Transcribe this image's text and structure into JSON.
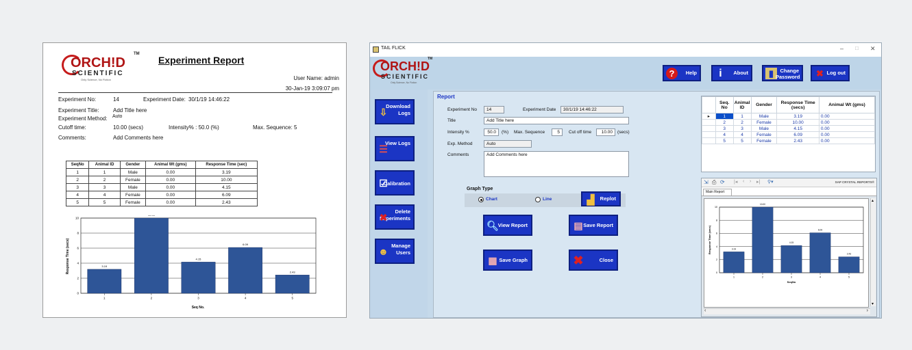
{
  "report_doc": {
    "logo": {
      "brand": "ORCH!D",
      "sub": "SCIENTIFIC",
      "tagline": "Only Science, No Fiction",
      "tm": "TM"
    },
    "title": "Experiment Report",
    "user_name": "User Name: admin",
    "printed_at": "30-Jan-19  3:09:07 pm",
    "experiment_no_label": "Experiment No:",
    "experiment_no": "14",
    "experiment_date_label": "Experiment Date:",
    "experiment_date": "30/1/19 14:46:22",
    "experiment_title_label": "Experiment Title:",
    "experiment_title": "Add Title here",
    "experiment_method_label": "Experiment Method:",
    "experiment_method": "Auto",
    "cutoff_label": "Cutoff time:",
    "cutoff": "10.00 (secs)",
    "intensity": "Intensity% : 50.0 (%)",
    "max_sequence": "Max. Sequence: 5",
    "comments_label": "Comments:",
    "comments": "Add Comments here",
    "table_headers": [
      "SeqNo",
      "Animal ID",
      "Gender",
      "Animal Wt (gms)",
      "Response Time (sec)"
    ],
    "table_rows": [
      [
        "1",
        "1",
        "Male",
        "0.00",
        "3.19"
      ],
      [
        "2",
        "2",
        "Female",
        "0.00",
        "10.00"
      ],
      [
        "3",
        "3",
        "Male",
        "0.00",
        "4.15"
      ],
      [
        "4",
        "4",
        "Female",
        "0.00",
        "6.09"
      ],
      [
        "5",
        "5",
        "Female",
        "0.00",
        "2.43"
      ]
    ],
    "chart_xlabel": "Seq No.",
    "chart_ylabel": "Response Time (secs)"
  },
  "app": {
    "window_title": "TAIL FLICK",
    "window_controls": {
      "minimize": "–",
      "maximize": "□",
      "close": "✕"
    },
    "logo": {
      "brand": "ORCH!D",
      "sub": "SCIENTIFIC",
      "tagline": "Only Science, No Fiction",
      "tm": "TM"
    },
    "top_buttons": {
      "help": "Help",
      "about": "About",
      "change_password": "Change Password",
      "logout": "Log out"
    },
    "sidebar": {
      "download_logs": "Download Logs",
      "view_logs": "View Logs",
      "calibration": "Calibration",
      "delete_experiments": "Delete Experiments",
      "manage_users": "Manage Users"
    },
    "report": {
      "heading": "Report",
      "experiment_no_label": "Experiment No",
      "experiment_no": "14",
      "experiment_date_label": "Experiment Date",
      "experiment_date": "30/1/19 14:46:22",
      "title_label": "Title",
      "title_value": "Add Title here",
      "intensity_label": "Intensity %",
      "intensity_value": "50.0",
      "intensity_unit": "(%)",
      "max_sequence_label": "Max. Sequence",
      "max_sequence_value": "5",
      "cutoff_label": "Cut off time",
      "cutoff_value": "10.00",
      "cutoff_unit": "(secs)",
      "method_label": "Exp. Method",
      "method_value": "Auto",
      "comments_label": "Comments",
      "comments_value": "Add Comments here",
      "graph_type_label": "Graph Type",
      "graph_type_options": [
        "Chart",
        "Line"
      ],
      "graph_type_selected": "Chart",
      "replot": "Replot",
      "view_report": "View Report",
      "save_report": "Save Report",
      "save_graph": "Save Graph",
      "close": "Close"
    },
    "grid": {
      "headers": [
        "Seq. No",
        "Animal ID",
        "Gender",
        "Response Time (secs)",
        "Animal Wt (gms)"
      ],
      "rows": [
        [
          "1",
          "1",
          "Male",
          "3.19",
          "0.00"
        ],
        [
          "2",
          "2",
          "Female",
          "10.00",
          "0.00"
        ],
        [
          "3",
          "3",
          "Male",
          "4.15",
          "0.00"
        ],
        [
          "4",
          "4",
          "Female",
          "6.09",
          "0.00"
        ],
        [
          "5",
          "5",
          "Female",
          "2.43",
          "0.00"
        ]
      ],
      "selected_row": 0
    },
    "viewer": {
      "brand": "SAP CRYSTAL REPORTS®",
      "tab": "Main Report",
      "chart_xlabel": "SeqNo",
      "chart_ylabel": "Response Time (secs)"
    }
  },
  "chart_data": [
    {
      "type": "bar",
      "categories": [
        "1",
        "2",
        "3",
        "4",
        "5"
      ],
      "values": [
        3.19,
        10.0,
        4.15,
        6.09,
        2.43
      ],
      "data_labels": [
        "3.19",
        "10.00",
        "4.15",
        "6.09",
        "2.43"
      ],
      "xlabel": "Seq No.",
      "ylabel": "Response Time (secs)",
      "ylim": [
        0,
        10
      ],
      "ticks": [
        "0",
        "2",
        "4",
        "6",
        "8",
        "10"
      ],
      "grid": true,
      "color": "#2e5597"
    },
    {
      "type": "bar",
      "categories": [
        "1",
        "2",
        "3",
        "4",
        "5"
      ],
      "values": [
        3.19,
        10.0,
        4.15,
        6.09,
        2.43
      ],
      "data_labels": [
        "3.19",
        "10.00",
        "4.15",
        "6.09",
        "2.43"
      ],
      "xlabel": "SeqNo",
      "ylabel": "Response Time (secs)",
      "ylim": [
        0,
        10
      ],
      "ticks": [
        "0",
        "2",
        "4",
        "6",
        "8",
        "10"
      ],
      "grid": true,
      "color": "#2e5597"
    }
  ],
  "colors": {
    "button_blue": "#1b35c4",
    "bar_blue": "#2e5597",
    "logo_red": "#c61b1b",
    "app_bg": "#c5d9ea"
  }
}
